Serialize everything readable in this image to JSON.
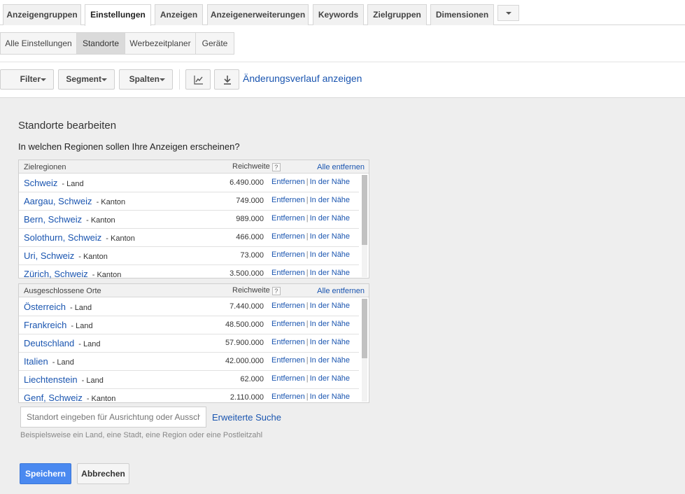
{
  "tabs": [
    {
      "label": "Anzeigengruppen",
      "active": false
    },
    {
      "label": "Einstellungen",
      "active": true
    },
    {
      "label": "Anzeigen",
      "active": false
    },
    {
      "label": "Anzeigenerweiterungen",
      "active": false
    },
    {
      "label": "Keywords",
      "active": false
    },
    {
      "label": "Zielgruppen",
      "active": false
    },
    {
      "label": "Dimensionen",
      "active": false
    }
  ],
  "subtabs": [
    {
      "label": "Alle Einstellungen",
      "active": false
    },
    {
      "label": "Standorte",
      "active": true
    },
    {
      "label": "Werbezeitplaner",
      "active": false
    },
    {
      "label": "Geräte",
      "active": false
    }
  ],
  "toolbar": {
    "filter_label": "Filter",
    "segment_label": "Segment",
    "columns_label": "Spalten",
    "chart_icon": "line-chart-icon",
    "download_icon": "download-icon",
    "history_link": "Änderungsverlauf anzeigen"
  },
  "panel": {
    "title": "Standorte bearbeiten",
    "question": "In welchen Regionen sollen Ihre Anzeigen erscheinen?"
  },
  "targets": {
    "col_name": "Zielregionen",
    "col_reach": "Reichweite",
    "help": "?",
    "remove_all": "Alle entfernen",
    "rows": [
      {
        "name": "Schweiz",
        "type": "- Land",
        "reach": "6.490.000",
        "remove": "Entfernen",
        "sep": "|",
        "near": "In der Nähe"
      },
      {
        "name": "Aargau, Schweiz",
        "type": "- Kanton",
        "reach": "749.000",
        "remove": "Entfernen",
        "sep": "|",
        "near": "In der Nähe"
      },
      {
        "name": "Bern, Schweiz",
        "type": "- Kanton",
        "reach": "989.000",
        "remove": "Entfernen",
        "sep": "|",
        "near": "In der Nähe"
      },
      {
        "name": "Solothurn, Schweiz",
        "type": "- Kanton",
        "reach": "466.000",
        "remove": "Entfernen",
        "sep": "|",
        "near": "In der Nähe"
      },
      {
        "name": "Uri, Schweiz",
        "type": "- Kanton",
        "reach": "73.000",
        "remove": "Entfernen",
        "sep": "|",
        "near": "In der Nähe"
      },
      {
        "name": "Zürich, Schweiz",
        "type": "- Kanton",
        "reach": "3.500.000",
        "remove": "Entfernen",
        "sep": "|",
        "near": "In der Nähe"
      }
    ]
  },
  "excluded": {
    "col_name": "Ausgeschlossene Orte",
    "col_reach": "Reichweite",
    "help": "?",
    "remove_all": "Alle entfernen",
    "rows": [
      {
        "name": "Österreich",
        "type": "- Land",
        "reach": "7.440.000",
        "remove": "Entfernen",
        "sep": "|",
        "near": "In der Nähe"
      },
      {
        "name": "Frankreich",
        "type": "- Land",
        "reach": "48.500.000",
        "remove": "Entfernen",
        "sep": "|",
        "near": "In der Nähe"
      },
      {
        "name": "Deutschland",
        "type": "- Land",
        "reach": "57.900.000",
        "remove": "Entfernen",
        "sep": "|",
        "near": "In der Nähe"
      },
      {
        "name": "Italien",
        "type": "- Land",
        "reach": "42.000.000",
        "remove": "Entfernen",
        "sep": "|",
        "near": "In der Nähe"
      },
      {
        "name": "Liechtenstein",
        "type": "- Land",
        "reach": "62.000",
        "remove": "Entfernen",
        "sep": "|",
        "near": "In der Nähe"
      },
      {
        "name": "Genf, Schweiz",
        "type": "- Kanton",
        "reach": "2.110.000",
        "remove": "Entfernen",
        "sep": "|",
        "near": "In der Nähe"
      }
    ]
  },
  "search": {
    "placeholder": "Standort eingeben für Ausrichtung oder Ausschluss",
    "advanced_link": "Erweiterte Suche",
    "hint": "Beispielsweise ein Land, eine Stadt, eine Region oder eine Postleitzahl"
  },
  "actions": {
    "save_label": "Speichern",
    "cancel_label": "Abbrechen"
  },
  "colors": {
    "link": "#1a55b0",
    "primary_button": "#4a89f0",
    "panel_bg": "#eeeeee"
  }
}
